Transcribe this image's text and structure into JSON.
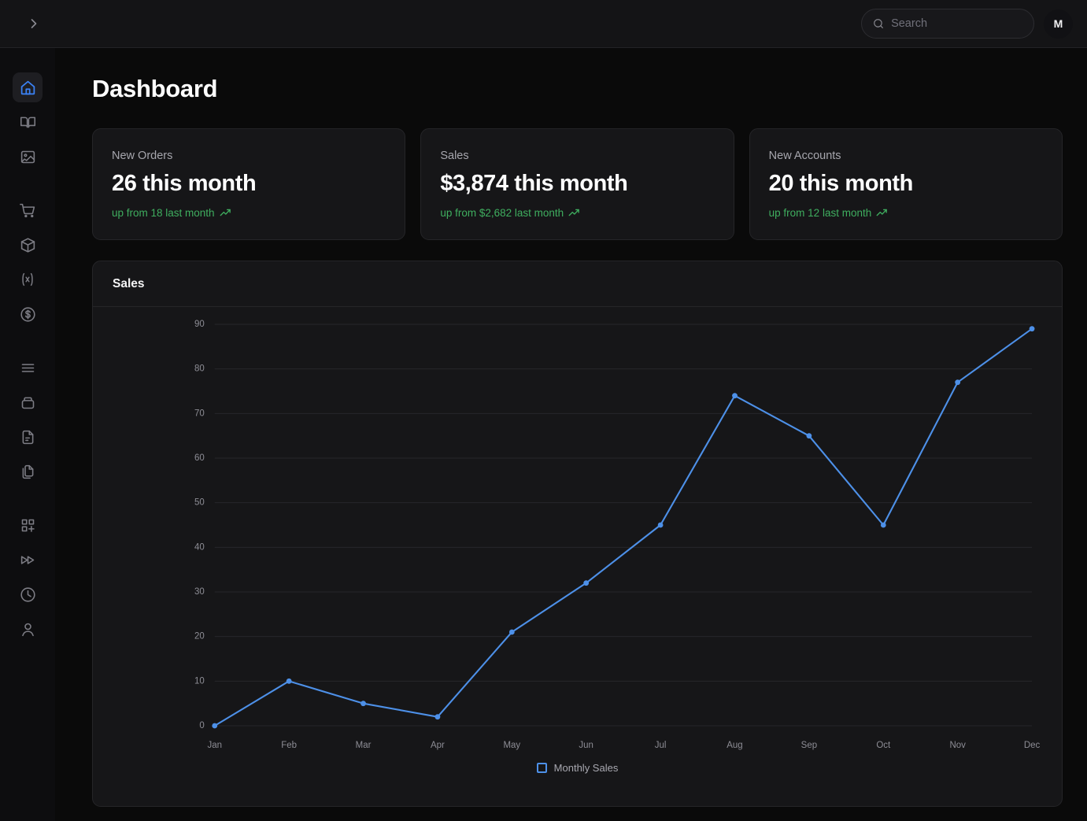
{
  "topbar": {
    "collapse_icon": "chevron-right-icon",
    "search": {
      "placeholder": "Search",
      "value": "",
      "icon": "search-icon"
    },
    "avatar_initial": "M"
  },
  "sidebar": {
    "items": [
      {
        "name": "home",
        "icon": "home-icon",
        "active": true
      },
      {
        "name": "book",
        "icon": "book-icon",
        "active": false
      },
      {
        "name": "images",
        "icon": "image-icon",
        "active": false
      },
      {
        "name": "orders",
        "icon": "shopping-cart-icon",
        "active": false
      },
      {
        "name": "products",
        "icon": "box-icon",
        "active": false
      },
      {
        "name": "variables",
        "icon": "variable-icon",
        "active": false
      },
      {
        "name": "payments",
        "icon": "dollar-circle-icon",
        "active": false
      },
      {
        "name": "lists",
        "icon": "list-icon",
        "active": false
      },
      {
        "name": "archive",
        "icon": "archive-icon",
        "active": false
      },
      {
        "name": "documents",
        "icon": "file-text-icon",
        "active": false
      },
      {
        "name": "copies",
        "icon": "copy-files-icon",
        "active": false
      },
      {
        "name": "add-widget",
        "icon": "grid-plus-icon",
        "active": false
      },
      {
        "name": "fast-forward",
        "icon": "fast-forward-icon",
        "active": false
      },
      {
        "name": "history",
        "icon": "clock-icon",
        "active": false
      },
      {
        "name": "account",
        "icon": "user-icon",
        "active": false
      }
    ]
  },
  "page": {
    "title": "Dashboard"
  },
  "stats": [
    {
      "label": "New Orders",
      "value": "26 this month",
      "delta": "up from 18 last month",
      "delta_icon": "trend-up-icon"
    },
    {
      "label": "Sales",
      "value": "$3,874 this month",
      "delta": "up from $2,682 last month",
      "delta_icon": "trend-up-icon"
    },
    {
      "label": "New Accounts",
      "value": "20 this month",
      "delta": "up from 12 last month",
      "delta_icon": "trend-up-icon"
    }
  ],
  "chart_card": {
    "title": "Sales"
  },
  "chart_data": {
    "type": "line",
    "title": "Sales",
    "xlabel": "",
    "ylabel": "",
    "categories": [
      "Jan",
      "Feb",
      "Mar",
      "Apr",
      "May",
      "Jun",
      "Jul",
      "Aug",
      "Sep",
      "Oct",
      "Nov",
      "Dec"
    ],
    "series": [
      {
        "name": "Monthly Sales",
        "color": "#4d90e8",
        "values": [
          0,
          10,
          5,
          2,
          21,
          32,
          45,
          74,
          65,
          45,
          77,
          89
        ]
      }
    ],
    "yticks": [
      0,
      10,
      20,
      30,
      40,
      50,
      60,
      70,
      80,
      90
    ],
    "ylim": [
      0,
      90
    ],
    "grid": true,
    "legend_position": "bottom",
    "markers": true
  },
  "colors": {
    "accent": "#3b82f6",
    "series": "#4d90e8",
    "positive": "#3fae5f",
    "page_bg": "#0a0a0a",
    "card_bg": "#161618",
    "sidebar_bg": "#0d0d0f"
  }
}
